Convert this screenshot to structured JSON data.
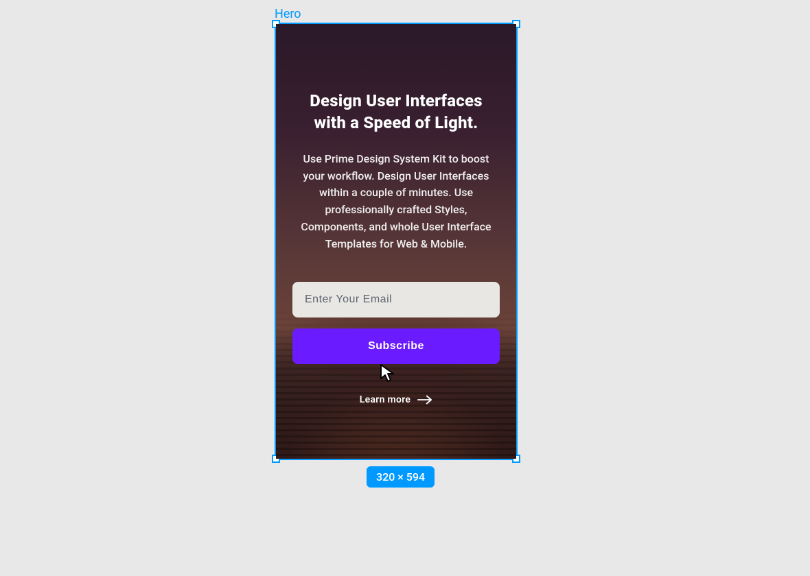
{
  "selection": {
    "label": "Hero",
    "dimensions": "320 × 594",
    "accent": "#0099ff"
  },
  "hero": {
    "headline": "Design User Interfaces with a Speed of Light.",
    "subtext": "Use Prime Design System Kit to boost your workflow. Design User Interfaces within a couple of minutes. Use professionally crafted Styles, Components, and whole User Interface Templates for Web & Mobile.",
    "email_placeholder": "Enter Your Email",
    "subscribe_label": "Subscribe",
    "learn_more_label": "Learn more",
    "button_color": "#6a1bff"
  }
}
